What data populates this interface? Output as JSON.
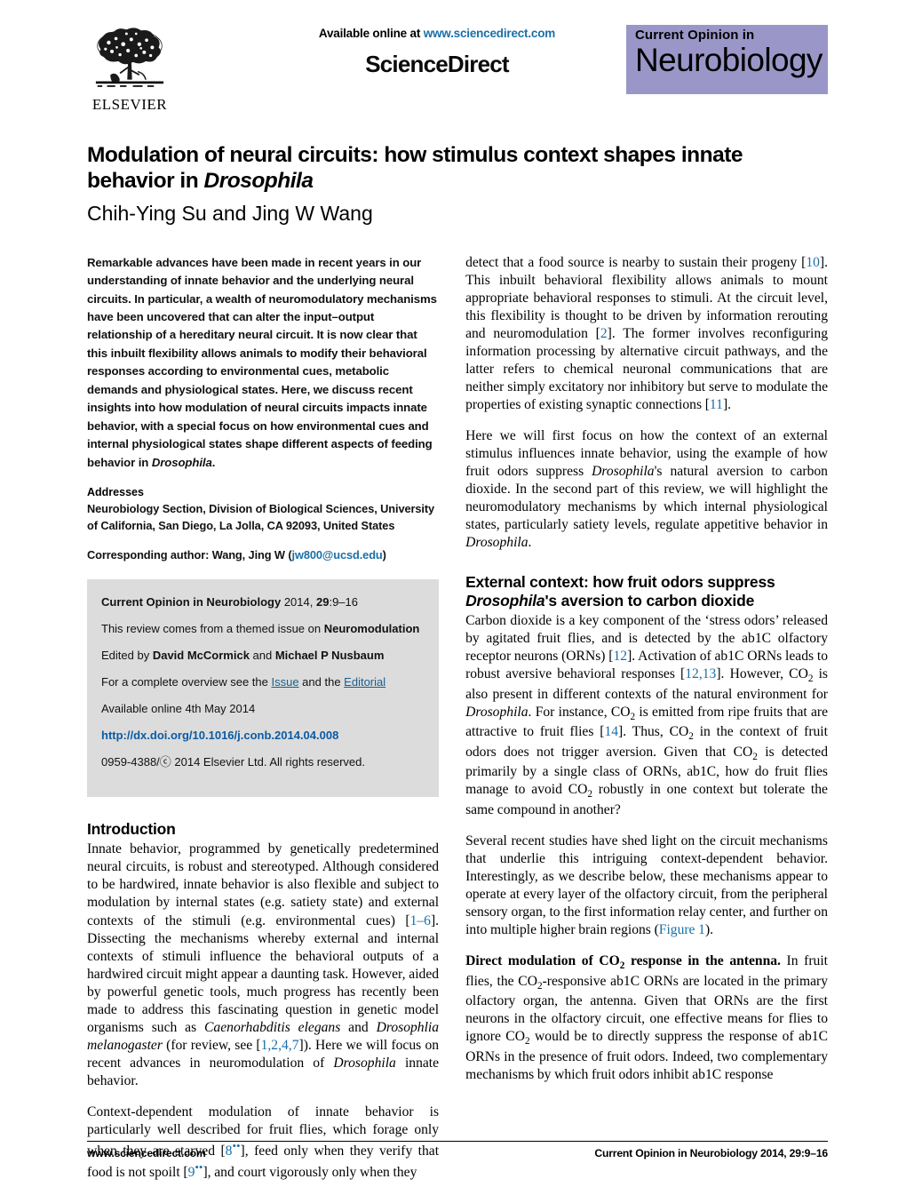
{
  "masthead": {
    "available_prefix": "Available online at ",
    "available_url": "www.sciencedirect.com",
    "sciencedirect": "ScienceDirect",
    "elsevier_wordmark": "ELSEVIER",
    "journal_logo_top": "Current Opinion in",
    "journal_logo_main": "Neurobiology",
    "logo_bg_color": "#9b96c8",
    "link_color": "#1a6fa8"
  },
  "article": {
    "title_line1": "Modulation of neural circuits: how stimulus context shapes innate",
    "title_line2_prefix": "behavior in ",
    "title_line2_italic": "Drosophila",
    "authors": "Chih-Ying Su and Jing W Wang"
  },
  "abstract": {
    "text_part1": "Remarkable advances have been made in recent years in our understanding of innate behavior and the underlying neural circuits. In particular, a wealth of neuromodulatory mechanisms have been uncovered that can alter the input–output relationship of a hereditary neural circuit. It is now clear that this inbuilt flexibility allows animals to modify their behavioral responses according to environmental cues, metabolic demands and physiological states. Here, we discuss recent insights into how modulation of neural circuits impacts innate behavior, with a special focus on how environmental cues and internal physiological states shape different aspects of feeding behavior in ",
    "text_italic": "Drosophila",
    "text_part2": "."
  },
  "addresses": {
    "label": "Addresses",
    "text": "Neurobiology Section, Division of Biological Sciences, University of California, San Diego, La Jolla, CA 92093, United States",
    "corresponding_prefix": "Corresponding author: Wang, Jing W (",
    "corresponding_email": "jw800@ucsd.edu",
    "corresponding_suffix": ")"
  },
  "infobox": {
    "citation_bold": "Current Opinion in Neurobiology",
    "citation_year": " 2014, ",
    "citation_volume": "29",
    "citation_pages": ":9–16",
    "themed_prefix": "This review comes from a themed issue on ",
    "themed_bold": "Neuromodulation",
    "edited_prefix": "Edited by ",
    "editor1": "David McCormick",
    "edited_mid": " and ",
    "editor2": "Michael P Nusbaum",
    "overview_prefix": "For a complete overview see the ",
    "overview_link1": "Issue",
    "overview_mid": " and the ",
    "overview_link2": "Editorial",
    "available_online": "Available online 4th May 2014",
    "doi": "http://dx.doi.org/10.1016/j.conb.2014.04.008",
    "copyright": "0959-4388/ⓒ 2014 Elsevier Ltd. All rights reserved."
  },
  "sections": {
    "introduction_heading": "Introduction",
    "intro_p1_a": "Innate behavior, programmed by genetically predetermined neural circuits, is robust and stereotyped. Although considered to be hardwired, innate behavior is also flexible and subject to modulation by internal states (e.g. satiety state) and external contexts of the stimuli (e.g. environmental cues) [",
    "intro_p1_ref1": "1–6",
    "intro_p1_b": "]. Dissecting the mechanisms whereby external and internal contexts of stimuli influence the behavioral outputs of a hardwired circuit might appear a daunting task. However, aided by powerful genetic tools, much progress has recently been made to address this fascinating question in genetic model organisms such as ",
    "intro_p1_it1": "Caenorhabditis elegans",
    "intro_p1_c": " and ",
    "intro_p1_it2": "Drosophlia melanogaster",
    "intro_p1_d": " (for review, see [",
    "intro_p1_ref2": "1,2,4,7",
    "intro_p1_e": "]). Here we will focus on recent advances in neuromodulation of ",
    "intro_p1_it3": "Drosophila",
    "intro_p1_f": " innate behavior.",
    "intro_p2_a": "Context-dependent modulation of innate behavior is particularly well described for fruit flies, which forage only when they are starved [",
    "intro_p2_ref1": "8",
    "intro_p2_sup1": "••",
    "intro_p2_b": "], feed only when they verify that food is not spoilt [",
    "intro_p2_ref2": "9",
    "intro_p2_sup2": "••",
    "intro_p2_c": "], and court vigorously only when they"
  },
  "right_column": {
    "p1_a": "detect that a food source is nearby to sustain their progeny [",
    "p1_ref1": "10",
    "p1_b": "]. This inbuilt behavioral flexibility allows animals to mount appropriate behavioral responses to stimuli. At the circuit level, this flexibility is thought to be driven by information rerouting and neuromodulation [",
    "p1_ref2": "2",
    "p1_c": "]. The former involves reconfiguring information processing by alternative circuit pathways, and the latter refers to chemical neuronal communications that are neither simply excitatory nor inhibitory but serve to modulate the properties of existing synaptic connections [",
    "p1_ref3": "11",
    "p1_d": "].",
    "p2_a": "Here we will first focus on how the context of an external stimulus influences innate behavior, using the example of how fruit odors suppress ",
    "p2_it1": "Drosophila",
    "p2_b": "'s natural aversion to carbon dioxide. In the second part of this review, we will highlight the neuromodulatory mechanisms by which internal physiological states, particularly satiety levels, regulate appetitive behavior in ",
    "p2_it2": "Drosophila",
    "p2_c": ".",
    "heading_line1": "External context: how fruit odors suppress",
    "heading_line2_italic": "Drosophila",
    "heading_line2_rest": "'s aversion to carbon dioxide",
    "p3_a": "Carbon dioxide is a key component of the ‘stress odors’ released by agitated fruit flies, and is detected by the ab1C olfactory receptor neurons (ORNs) [",
    "p3_ref1": "12",
    "p3_b": "]. Activation of ab1C ORNs leads to robust aversive behavioral responses [",
    "p3_ref2": "12,13",
    "p3_c": "]. However, CO",
    "p3_sub1": "2",
    "p3_d": " is also present in different contexts of the natural environment for ",
    "p3_it1": "Drosophila",
    "p3_e": ". For instance, CO",
    "p3_sub2": "2",
    "p3_f": " is emitted from ripe fruits that are attractive to fruit flies [",
    "p3_ref3": "14",
    "p3_g": "]. Thus, CO",
    "p3_sub3": "2",
    "p3_h": " in the context of fruit odors does not trigger aversion. Given that CO",
    "p3_sub4": "2",
    "p3_i": " is detected primarily by a single class of ORNs, ab1C, how do fruit flies manage to avoid CO",
    "p3_sub5": "2",
    "p3_j": " robustly in one context but tolerate the same compound in another?",
    "p4_a": "Several recent studies have shed light on the circuit mechanisms that underlie this intriguing context-dependent behavior. Interestingly, as we describe below, these mechanisms appear to operate at every layer of the olfactory circuit, from the peripheral sensory organ, to the first information relay center, and further on into multiple higher brain regions (",
    "p4_figref": "Figure 1",
    "p4_b": ").",
    "p5_bold_a": "Direct modulation of CO",
    "p5_bold_sub": "2",
    "p5_bold_b": " response in the antenna.",
    "p5_a": " In fruit flies, the CO",
    "p5_sub1": "2",
    "p5_b": "-responsive ab1C ORNs are located in the primary olfactory organ, the antenna. Given that ORNs are the first neurons in the olfactory circuit, one effective means for flies to ignore CO",
    "p5_sub2": "2",
    "p5_c": " would be to directly suppress the response of ab1C ORNs in the presence of fruit odors. Indeed, two complementary mechanisms by which fruit odors inhibit ab1C response"
  },
  "footer": {
    "left": "www.sciencedirect.com",
    "right_bold": "Current Opinion in Neurobiology",
    "right_rest": " 2014, ",
    "right_volume": "29",
    "right_pages": ":9–16"
  }
}
